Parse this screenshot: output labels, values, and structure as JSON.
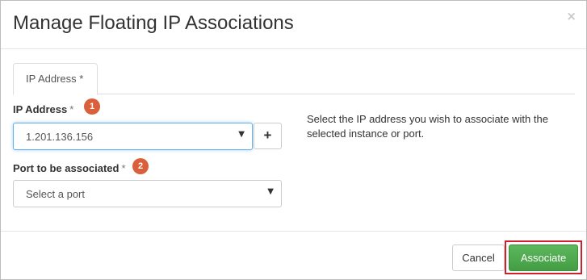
{
  "modal": {
    "title": "Manage Floating IP Associations",
    "close_label": "×"
  },
  "tabs": [
    {
      "label": "IP Address",
      "required_mark": "*"
    }
  ],
  "form": {
    "ip_address": {
      "label": "IP Address",
      "required_mark": "*",
      "step": "1",
      "selected_value": "1.201.136.156",
      "add_button_label": "+"
    },
    "port": {
      "label": "Port to be associated",
      "required_mark": "*",
      "step": "2",
      "selected_value": "Select a port"
    },
    "help_text": "Select the IP address you wish to associate with the selected instance or port."
  },
  "footer": {
    "cancel_label": "Cancel",
    "associate_label": "Associate"
  },
  "icons": {
    "dropdown": "caret-down-icon",
    "add": "plus-icon",
    "close": "close-icon"
  },
  "colors": {
    "primary_button": "#5cb85c",
    "step_badge": "#d9603b",
    "highlight": "#d0202a",
    "focus": "#66afe9"
  }
}
